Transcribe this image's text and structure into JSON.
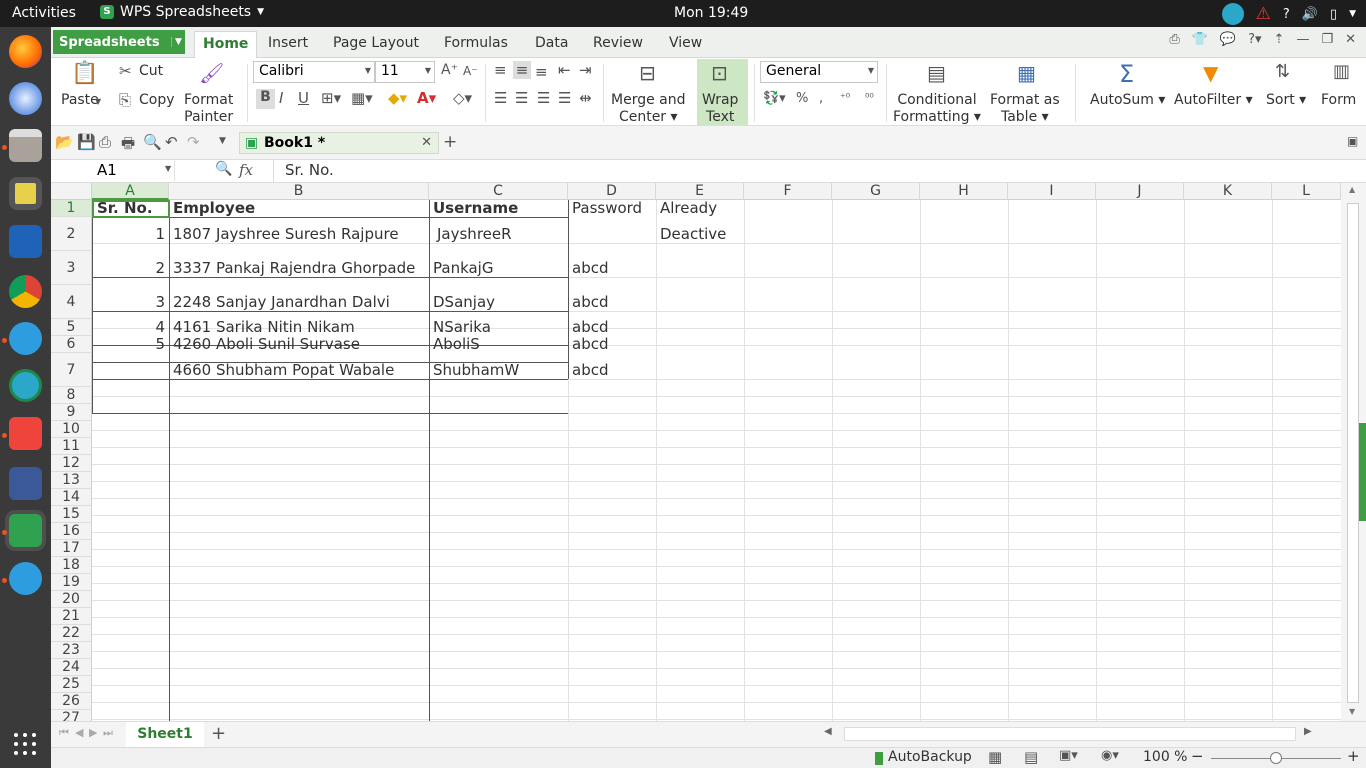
{
  "topbar": {
    "activities": "Activities",
    "app_name": "WPS Spreadsheets",
    "clock": "Mon 19:49",
    "help": "?"
  },
  "app": {
    "menu_label": "Spreadsheets",
    "tabs": [
      "Home",
      "Insert",
      "Page Layout",
      "Formulas",
      "Data",
      "Review",
      "View"
    ]
  },
  "ribbon": {
    "paste": "Paste",
    "cut": "Cut",
    "copy": "Copy",
    "format_painter": [
      "Format",
      "Painter"
    ],
    "font": "Calibri",
    "size": "11",
    "merge": [
      "Merge and",
      "Center"
    ],
    "wrap": [
      "Wrap",
      "Text"
    ],
    "number_format": "General",
    "conditional": [
      "Conditional",
      "Formatting"
    ],
    "format_table": [
      "Format as",
      "Table"
    ],
    "autosum": "AutoSum",
    "autofilter": "AutoFilter",
    "sort": "Sort",
    "form": "Form"
  },
  "doc": {
    "tab": "Book1 *"
  },
  "formula": {
    "cell_ref": "A1",
    "fx": "fx",
    "content": "Sr. No."
  },
  "columns": [
    "A",
    "B",
    "C",
    "D",
    "E",
    "F",
    "G",
    "H",
    "I",
    "J",
    "K",
    "L"
  ],
  "rows": [
    "1",
    "2",
    "3",
    "4",
    "5",
    "6",
    "7",
    "8",
    "9",
    "10",
    "11",
    "12",
    "13",
    "14",
    "15",
    "16",
    "17",
    "18",
    "19",
    "20",
    "21",
    "22",
    "23",
    "24",
    "25",
    "26",
    "27"
  ],
  "table": {
    "header": [
      "Sr. No.",
      "Employee",
      "Username",
      "Password",
      "Already"
    ],
    "r2": [
      "1",
      "1807 Jayshree Suresh Rajpure",
      "JayshreeR",
      "",
      "Deactive"
    ],
    "r3": [
      "2",
      "3337 Pankaj Rajendra Ghorpade",
      "PankajG",
      "abcd",
      ""
    ],
    "r4": [
      "3",
      "2248 Sanjay Janardhan Dalvi",
      "DSanjay",
      "abcd",
      ""
    ],
    "r5": [
      "4",
      "4161 Sarika Nitin Nikam",
      "NSarika",
      "abcd",
      ""
    ],
    "r6": [
      "5",
      "4260 Aboli Sunil Survase",
      "AboliS",
      "abcd",
      ""
    ],
    "r7": [
      "",
      "4660 Shubham Popat Wabale",
      "ShubhamW",
      "abcd",
      ""
    ]
  },
  "sheet": {
    "name": "Sheet1",
    "add": "+"
  },
  "status": {
    "autobackup": "AutoBackup",
    "zoom": "100 %"
  }
}
